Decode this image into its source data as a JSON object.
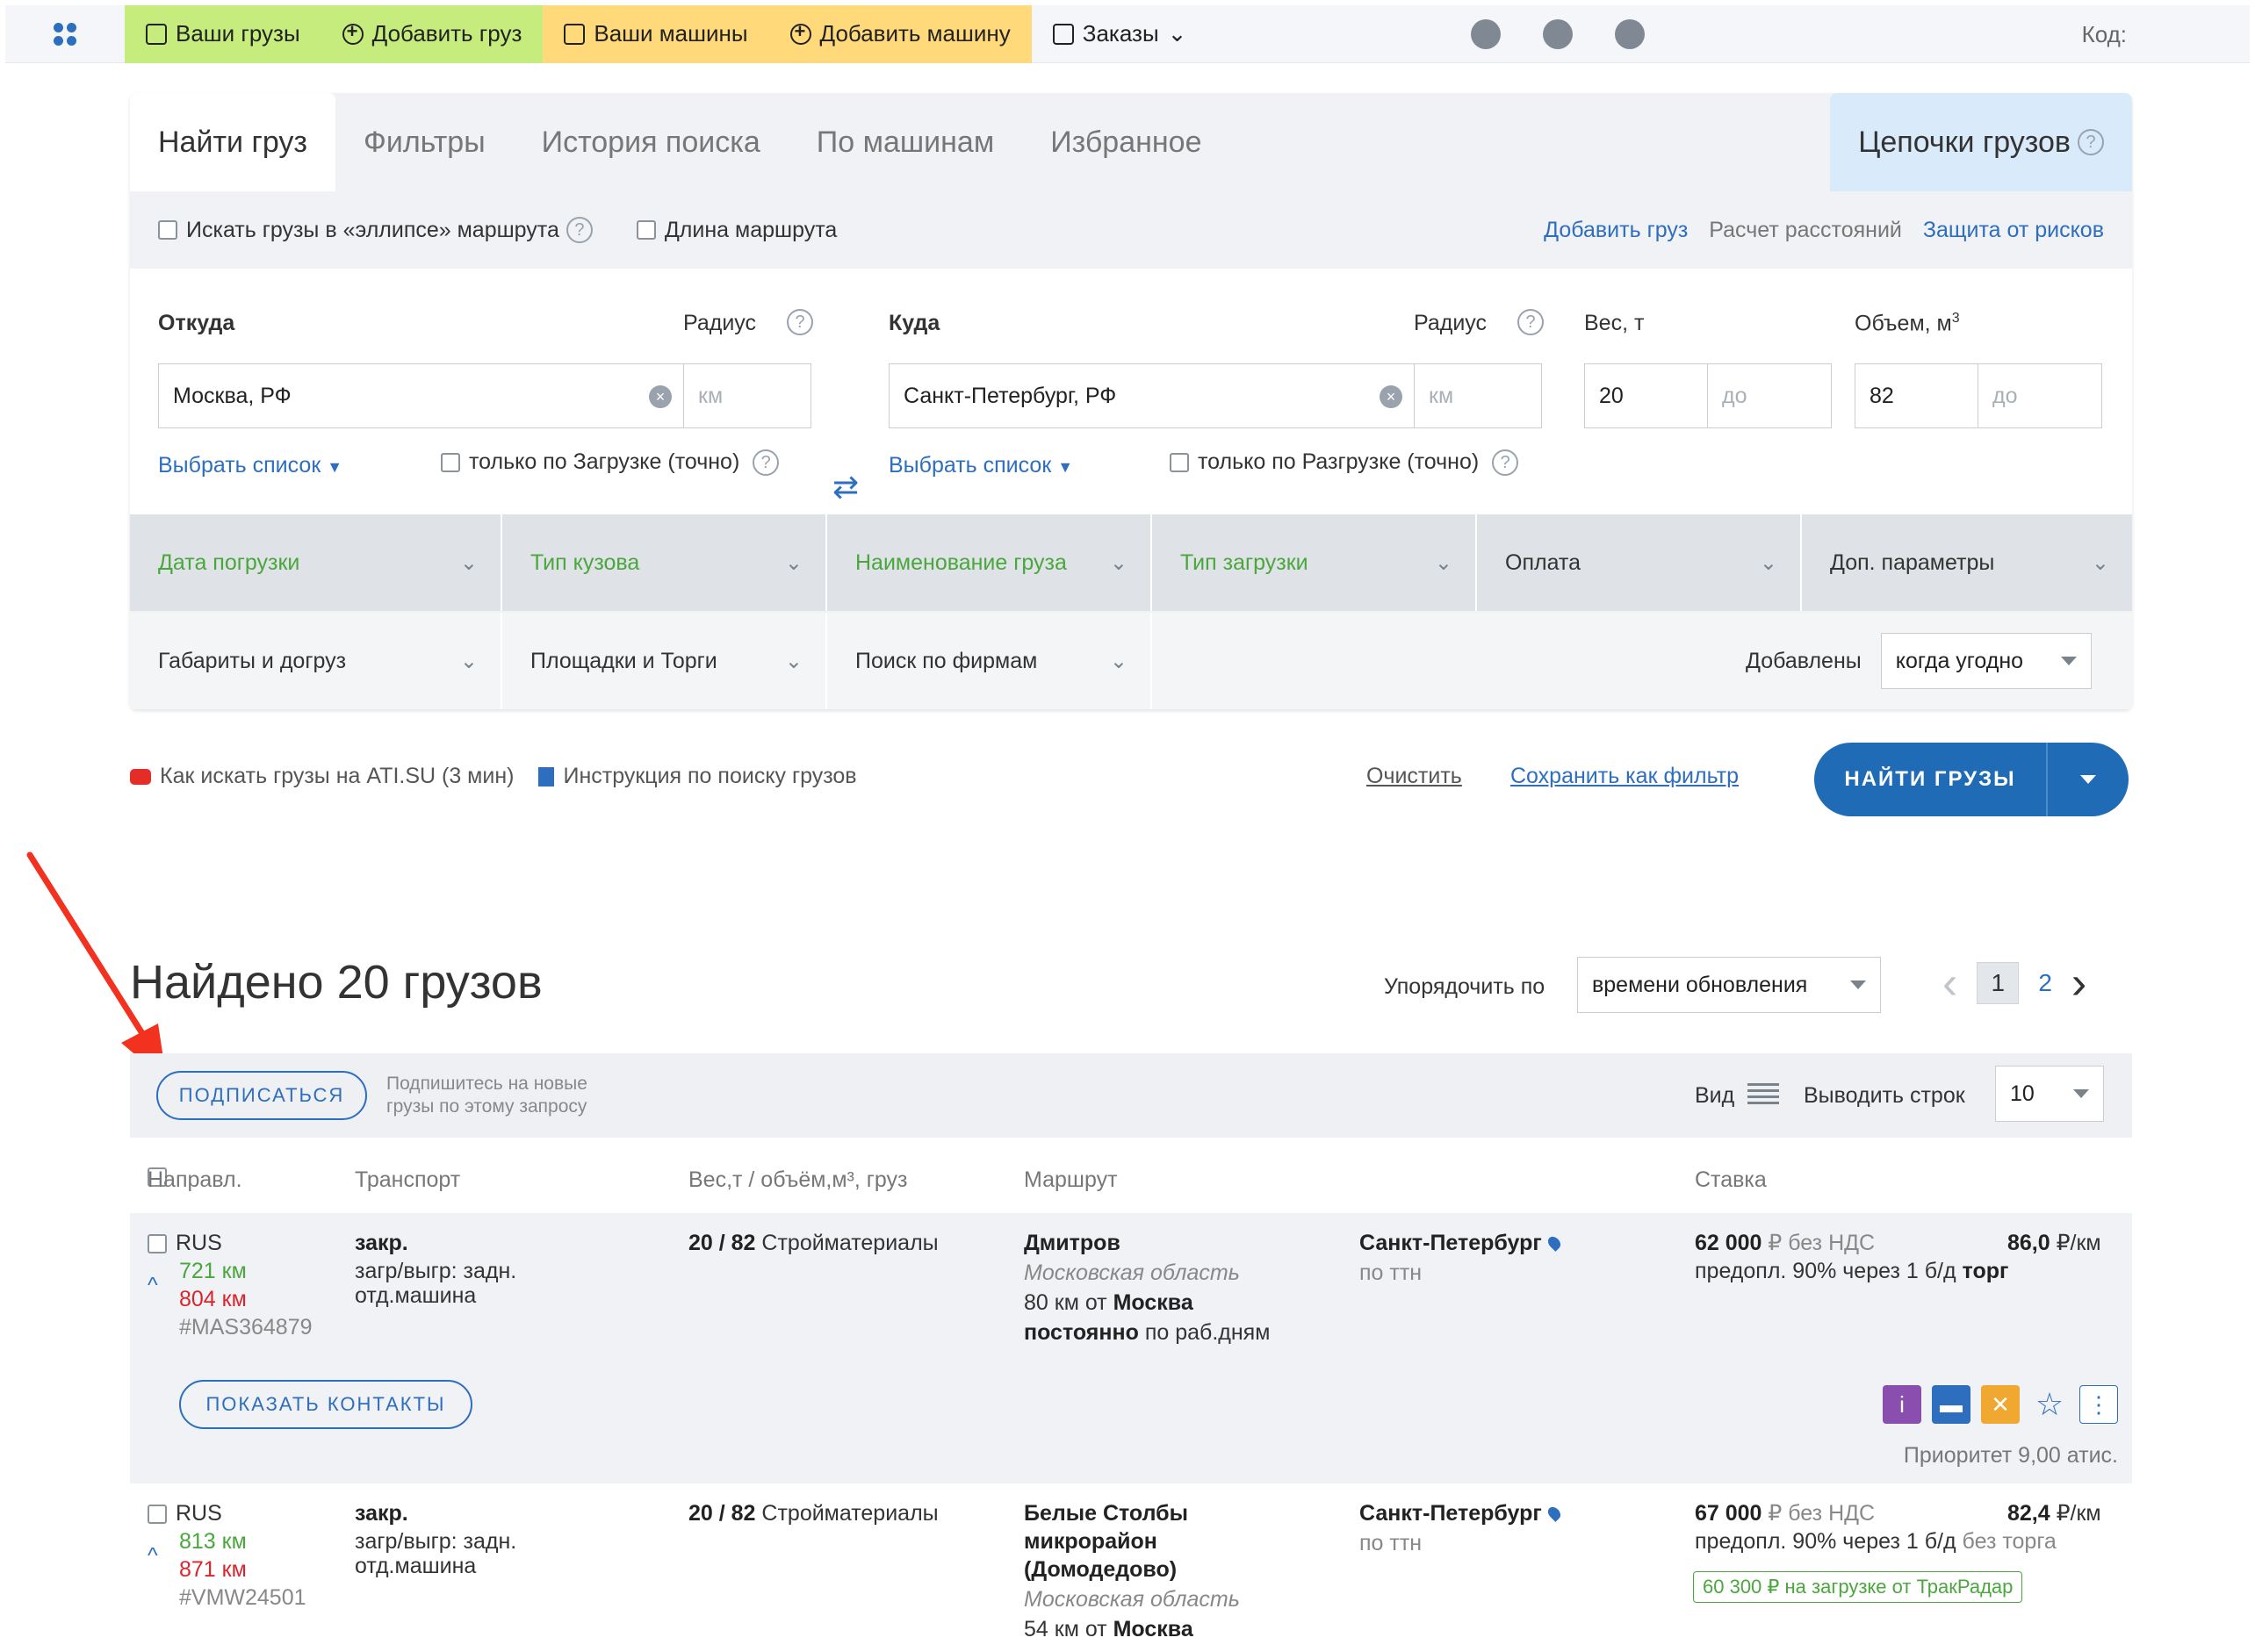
{
  "topnav": {
    "items": [
      {
        "label": "Ваши грузы",
        "icon": "box-icon"
      },
      {
        "label": "Добавить груз",
        "icon": "plus-circle-icon"
      },
      {
        "label": "Ваши машины",
        "icon": "truck-icon"
      },
      {
        "label": "Добавить машину",
        "icon": "plus-circle-icon"
      },
      {
        "label": "Заказы",
        "icon": "orders-icon"
      }
    ],
    "code_label": "Код:"
  },
  "tabs": {
    "find": "Найти груз",
    "filters": "Фильтры",
    "history": "История поиска",
    "by_trucks": "По машинам",
    "favorites": "Избранное",
    "chains": "Цепочки грузов"
  },
  "options": {
    "ellipse": "Искать грузы в «эллипсе» маршрута",
    "route_length": "Длина маршрута",
    "add_cargo": "Добавить груз",
    "distance_calc": "Расчет расстояний",
    "risk_protection": "Защита от рисков"
  },
  "form": {
    "from_label": "Откуда",
    "from_value": "Москва, РФ",
    "radius_label": "Радиус",
    "km_placeholder": "км",
    "to_label": "Куда",
    "to_value": "Санкт-Петербург, РФ",
    "weight_label": "Вес, т",
    "weight_from": "20",
    "volume_label": "Объем, м",
    "volume_sup": "3",
    "volume_from": "82",
    "to_placeholder": "до",
    "select_list": "Выбрать список",
    "only_loading": "только по Загрузке (точно)",
    "only_unloading": "только по Разгрузке (точно)"
  },
  "filters": {
    "row1": [
      "Дата погрузки",
      "Тип кузова",
      "Наименование груза",
      "Тип загрузки",
      "Оплата",
      "Доп. параметры"
    ],
    "row2": [
      "Габариты и догруз",
      "Площадки и Торги",
      "Поиск по фирмам"
    ],
    "added_label": "Добавлены",
    "added_value": "когда угодно"
  },
  "help": {
    "video": "Как искать грузы на ATI.SU (3 мин)",
    "instruction": "Инструкция по поиску грузов",
    "clear": "Очистить",
    "save_filter": "Сохранить как фильтр",
    "find_button": "НАЙТИ ГРУЗЫ"
  },
  "results": {
    "found_title": "Найдено 20 грузов",
    "sort_label": "Упорядочить по",
    "sort_value": "времени обновления",
    "page_current": "1",
    "page_next": "2",
    "subscribe_button": "ПОДПИСАТЬСЯ",
    "subscribe_hint_1": "Подпишитесь на новые",
    "subscribe_hint_2": "грузы по этому запросу",
    "view_label": "Вид",
    "rows_label": "Выводить строк",
    "rows_value": "10"
  },
  "table": {
    "headers": [
      "Направл.",
      "Транспорт",
      "Вес,т / объём,м³, груз",
      "Маршрут",
      "Ставка"
    ],
    "rows": [
      {
        "country": "RUS",
        "km_green": "721 км",
        "km_red": "804 км",
        "id": "#MAS364879",
        "transport": "закр.",
        "transport_2": "загр/выгр: задн.",
        "transport_3": "отд.машина",
        "weight_volume": "20 / 82",
        "cargo": "Стройматериалы",
        "from_city": "Дмитров",
        "from_region": "Московская область",
        "from_dist": "80 км от",
        "from_dist_city": "Москва",
        "schedule_bold": "постоянно",
        "schedule": "по раб.дням",
        "to_city": "Санкт-Петербург",
        "to_note": "по ттн",
        "price": "62 000",
        "price_suffix": "₽ без НДС",
        "per_km": "86,0",
        "per_km_unit": "₽/км",
        "payment": "предопл. 90% через 1 б/д",
        "bargain": "торг",
        "contacts_button": "ПОКАЗАТЬ КОНТАКТЫ",
        "priority": "Приоритет 9,00 атис."
      },
      {
        "country": "RUS",
        "km_green": "813 км",
        "km_red": "871 км",
        "id": "#VMW24501",
        "transport": "закр.",
        "transport_2": "загр/выгр: задн.",
        "transport_3": "отд.машина",
        "weight_volume": "20 / 82",
        "cargo": "Стройматериалы",
        "from_city_1": "Белые Столбы",
        "from_city_2": "микрорайон",
        "from_city_3": "(Домодедово)",
        "from_region": "Московская область",
        "from_dist": "54 км от",
        "from_dist_city": "Москва",
        "to_city": "Санкт-Петербург",
        "to_note": "по ттн",
        "price": "67 000",
        "price_suffix": "₽ без НДС",
        "per_km": "82,4",
        "per_km_unit": "₽/км",
        "payment": "предопл. 90% через 1 б/д",
        "bargain": "без торга",
        "tag": "60 300 ₽ на загрузке от ТракРадар"
      }
    ]
  }
}
